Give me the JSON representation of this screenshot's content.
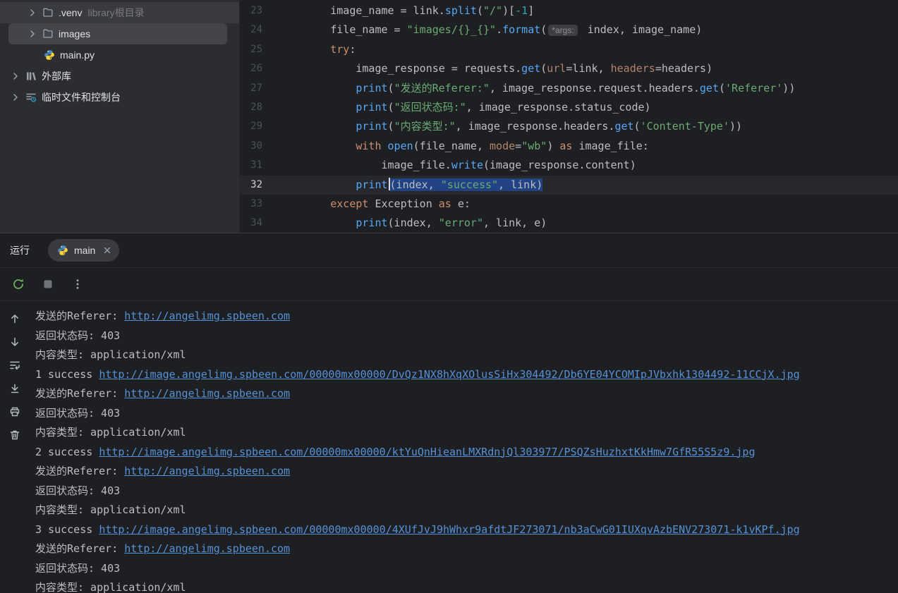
{
  "colors": {
    "panel_bg": "#2b2d30",
    "editor_bg": "#1e1f22",
    "keyword": "#cf8e6d",
    "string": "#6aab73",
    "function_call": "#56a8f5",
    "named_argument": "#b3846b",
    "number": "#2aacb8",
    "selection": "#214283",
    "console_link": "#5591d6",
    "rerun_green": "#6fb360"
  },
  "project_tree": {
    "items": [
      {
        "id": "venv",
        "label": ".venv",
        "suffix": "library根目录",
        "icon": "folder-icon",
        "chevron": true,
        "indent": 1,
        "state": "hover"
      },
      {
        "id": "images",
        "label": "images",
        "suffix": "",
        "icon": "folder-icon",
        "chevron": true,
        "indent": 1,
        "state": "selected"
      },
      {
        "id": "main-py",
        "label": "main.py",
        "suffix": "",
        "icon": "python-icon",
        "chevron": false,
        "indent": 1,
        "state": ""
      },
      {
        "id": "external-libraries",
        "label": "外部库",
        "suffix": "",
        "icon": "library-icon",
        "chevron": true,
        "indent": 0,
        "state": ""
      },
      {
        "id": "scratches-and-consoles",
        "label": "临时文件和控制台",
        "suffix": "",
        "icon": "scratch-icon",
        "chevron": true,
        "indent": 0,
        "state": ""
      }
    ]
  },
  "editor": {
    "lines": [
      {
        "num": 23,
        "caret_line": false,
        "tokens": [
          [
            "d",
            "        image_name = link."
          ],
          [
            "f",
            "split"
          ],
          [
            "d",
            "("
          ],
          [
            "s",
            "\"/\""
          ],
          [
            "d",
            ")["
          ],
          [
            "n",
            "-1"
          ],
          [
            "d",
            "]"
          ]
        ]
      },
      {
        "num": 24,
        "caret_line": false,
        "tokens": [
          [
            "d",
            "        file_name = "
          ],
          [
            "s",
            "\"images/{}_{}\""
          ],
          [
            "d",
            "."
          ],
          [
            "f",
            "format"
          ],
          [
            "d",
            "("
          ],
          [
            "hint",
            "*args:"
          ],
          [
            "d",
            " index, image_name)"
          ]
        ]
      },
      {
        "num": 25,
        "caret_line": false,
        "tokens": [
          [
            "d",
            "        "
          ],
          [
            "k",
            "try"
          ],
          [
            "d",
            ":"
          ]
        ]
      },
      {
        "num": 26,
        "caret_line": false,
        "tokens": [
          [
            "d",
            "            image_response = requests."
          ],
          [
            "f",
            "get"
          ],
          [
            "d",
            "("
          ],
          [
            "p",
            "url"
          ],
          [
            "d",
            "=link, "
          ],
          [
            "p",
            "headers"
          ],
          [
            "d",
            "=headers)"
          ]
        ]
      },
      {
        "num": 27,
        "caret_line": false,
        "tokens": [
          [
            "d",
            "            "
          ],
          [
            "f",
            "print"
          ],
          [
            "d",
            "("
          ],
          [
            "s",
            "\"发送的Referer:\""
          ],
          [
            "d",
            ", image_response.request.headers."
          ],
          [
            "f",
            "get"
          ],
          [
            "d",
            "("
          ],
          [
            "s",
            "'Referer'"
          ],
          [
            "d",
            "))"
          ]
        ]
      },
      {
        "num": 28,
        "caret_line": false,
        "tokens": [
          [
            "d",
            "            "
          ],
          [
            "f",
            "print"
          ],
          [
            "d",
            "("
          ],
          [
            "s",
            "\"返回状态码:\""
          ],
          [
            "d",
            ", image_response.status_code)"
          ]
        ]
      },
      {
        "num": 29,
        "caret_line": false,
        "tokens": [
          [
            "d",
            "            "
          ],
          [
            "f",
            "print"
          ],
          [
            "d",
            "("
          ],
          [
            "s",
            "\"内容类型:\""
          ],
          [
            "d",
            ", image_response.headers."
          ],
          [
            "f",
            "get"
          ],
          [
            "d",
            "("
          ],
          [
            "s",
            "'Content-Type'"
          ],
          [
            "d",
            "))"
          ]
        ]
      },
      {
        "num": 30,
        "caret_line": false,
        "tokens": [
          [
            "d",
            "            "
          ],
          [
            "k",
            "with"
          ],
          [
            "d",
            " "
          ],
          [
            "f",
            "open"
          ],
          [
            "d",
            "(file_name, "
          ],
          [
            "p",
            "mode"
          ],
          [
            "d",
            "="
          ],
          [
            "s",
            "\"wb\""
          ],
          [
            "d",
            ") "
          ],
          [
            "k",
            "as"
          ],
          [
            "d",
            " image_file:"
          ]
        ]
      },
      {
        "num": 31,
        "caret_line": false,
        "tokens": [
          [
            "d",
            "                image_file."
          ],
          [
            "f",
            "write"
          ],
          [
            "d",
            "(image_response.content)"
          ]
        ]
      },
      {
        "num": 32,
        "caret_line": true,
        "tokens": [
          [
            "d",
            "            "
          ],
          [
            "f",
            "print"
          ],
          [
            "caret",
            ""
          ],
          [
            "d",
            "(index, ",
            "sel"
          ],
          [
            "s",
            "\"success\"",
            "sel"
          ],
          [
            "d",
            ", link)",
            "sel"
          ]
        ]
      },
      {
        "num": 33,
        "caret_line": false,
        "tokens": [
          [
            "d",
            "        "
          ],
          [
            "k",
            "except"
          ],
          [
            "d",
            " Exception "
          ],
          [
            "k",
            "as"
          ],
          [
            "d",
            " e:"
          ]
        ]
      },
      {
        "num": 34,
        "caret_line": false,
        "tokens": [
          [
            "d",
            "            "
          ],
          [
            "f",
            "print"
          ],
          [
            "d",
            "(index, "
          ],
          [
            "s",
            "\"error\""
          ],
          [
            "d",
            ", link, e)"
          ]
        ]
      }
    ]
  },
  "run_panel": {
    "title": "运行",
    "tab_label": "main"
  },
  "console": {
    "toolbar_icons": [
      "rerun-icon",
      "stop-icon",
      "more-icon"
    ],
    "gutter_icons": [
      "arrow-up-icon",
      "arrow-down-icon",
      "soft-wrap-icon",
      "scroll-to-end-icon",
      "print-icon",
      "clear-icon"
    ],
    "lines": [
      [
        [
          "发送的Referer: ",
          "t"
        ],
        [
          "http://angelimg.spbeen.com",
          "link"
        ]
      ],
      [
        [
          "返回状态码: 403",
          "t"
        ]
      ],
      [
        [
          "内容类型: application/xml",
          "t"
        ]
      ],
      [
        [
          "1 success ",
          "t"
        ],
        [
          "http://image.angelimg.spbeen.com/00000mx00000/DvQz1NX8hXqXOlusSiHx304492/Db6YE04YCOMIpJVbxhk1304492-11CCjX.jpg",
          "link"
        ]
      ],
      [
        [
          "发送的Referer: ",
          "t"
        ],
        [
          "http://angelimg.spbeen.com",
          "link"
        ]
      ],
      [
        [
          "返回状态码: 403",
          "t"
        ]
      ],
      [
        [
          "内容类型: application/xml",
          "t"
        ]
      ],
      [
        [
          "2 success ",
          "t"
        ],
        [
          "http://image.angelimg.spbeen.com/00000mx00000/ktYuQnHieanLMXRdnjQl303977/PSQZsHuzhxtKkHmw7GfR55S5z9.jpg",
          "link"
        ]
      ],
      [
        [
          "发送的Referer: ",
          "t"
        ],
        [
          "http://angelimg.spbeen.com",
          "link"
        ]
      ],
      [
        [
          "返回状态码: 403",
          "t"
        ]
      ],
      [
        [
          "内容类型: application/xml",
          "t"
        ]
      ],
      [
        [
          "3 success ",
          "t"
        ],
        [
          "http://image.angelimg.spbeen.com/00000mx00000/4XUfJvJ9hWhxr9afdtJF273071/nb3aCwG01IUXqvAzbENV273071-k1vKPf.jpg",
          "link"
        ]
      ],
      [
        [
          "发送的Referer: ",
          "t"
        ],
        [
          "http://angelimg.spbeen.com",
          "link"
        ]
      ],
      [
        [
          "返回状态码: 403",
          "t"
        ]
      ],
      [
        [
          "内容类型: application/xml",
          "t"
        ]
      ]
    ]
  }
}
